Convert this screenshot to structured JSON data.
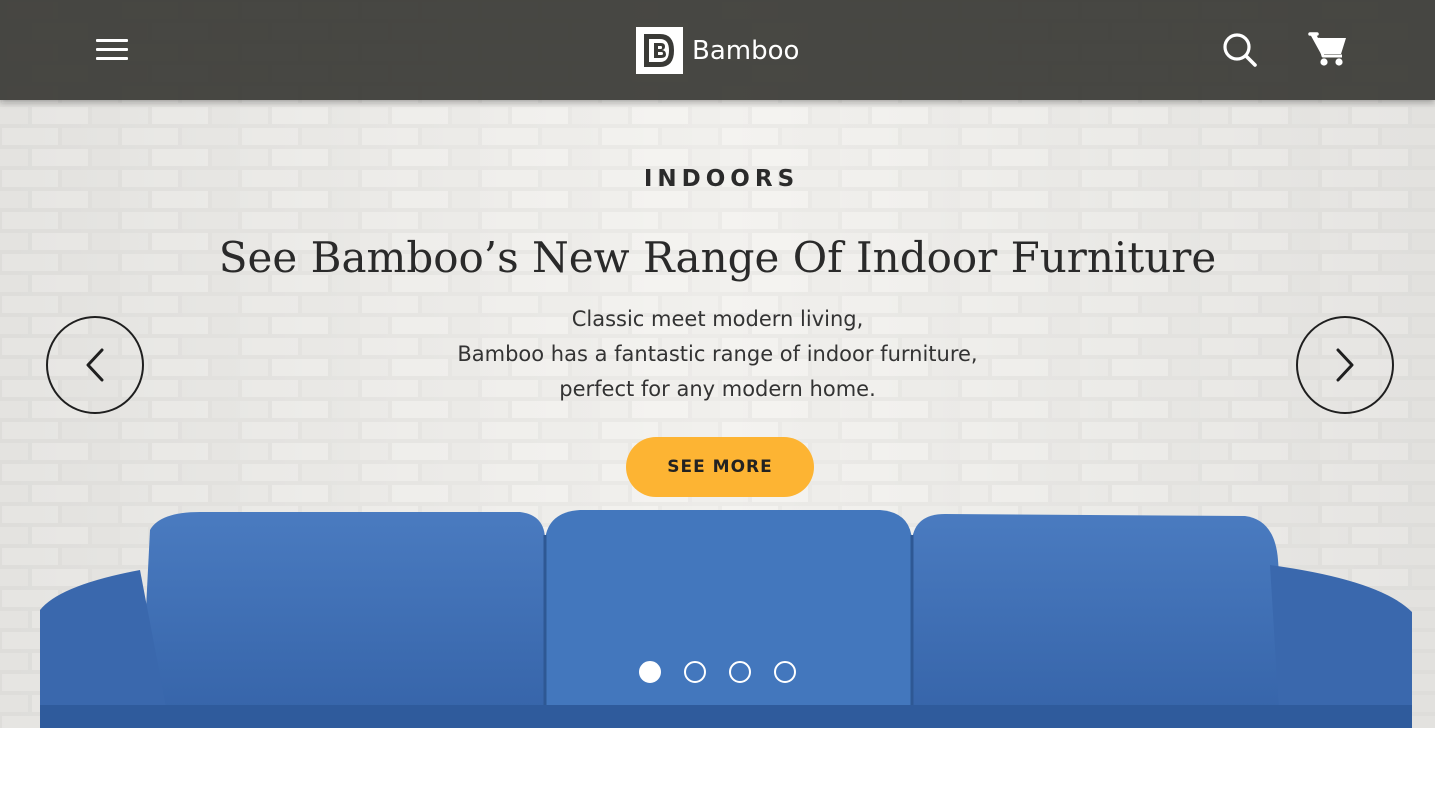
{
  "header": {
    "brand_name": "Bamboo",
    "icons": {
      "menu": "hamburger-menu-icon",
      "search": "search-icon",
      "cart": "shopping-cart-icon"
    }
  },
  "hero": {
    "eyebrow": "INDOORS",
    "headline": "See Bamboo’s New Range Of Indoor Furniture",
    "description_lines": [
      "Classic meet modern living,",
      "Bamboo has a fantastic range of indoor furniture,",
      "perfect for any modern home."
    ],
    "cta_label": "SEE MORE",
    "prev_icon": "chevron-left-icon",
    "next_icon": "chevron-right-icon",
    "slides_total": 4,
    "active_slide": 1
  },
  "colors": {
    "header_bg": "#3a3a36",
    "accent": "#fdb433",
    "sofa": "#3f6fb5",
    "wall": "#e9e9e7"
  }
}
